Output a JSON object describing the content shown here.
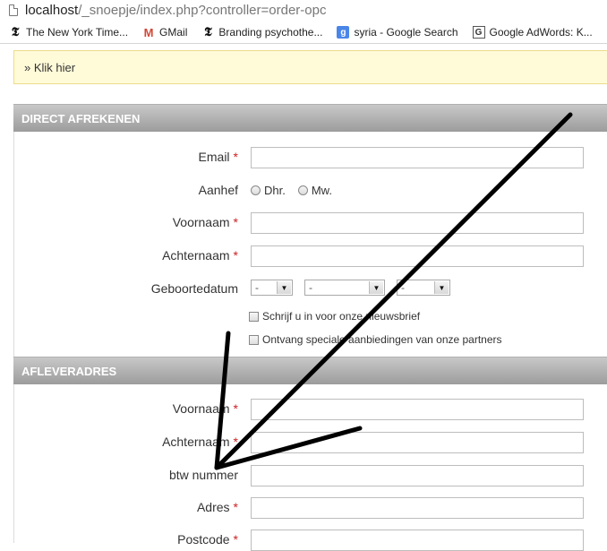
{
  "browser": {
    "url_host": "localhost",
    "url_path": "/_snoepje/index.php?controller=order-opc",
    "bookmarks": [
      {
        "label": "The New York Time...",
        "icon": "nyt-icon"
      },
      {
        "label": "GMail",
        "icon": "gmail-icon"
      },
      {
        "label": "Branding psychothe...",
        "icon": "nyt-icon"
      },
      {
        "label": "syria - Google Search",
        "icon": "google-search-icon"
      },
      {
        "label": "Google AdWords: K...",
        "icon": "adwords-icon"
      }
    ]
  },
  "notice": {
    "text": "» Klik hier"
  },
  "section_direct": {
    "title": "DIRECT AFREKENEN",
    "email_label": "Email",
    "aanhef_label": "Aanhef",
    "aanhef_options": [
      "Dhr.",
      "Mw."
    ],
    "voornaam_label": "Voornaam",
    "achternaam_label": "Achternaam",
    "geboortedatum_label": "Geboortedatum",
    "day_value": "-",
    "month_value": "-",
    "year_value": "-",
    "newsletter_label": "Schrijf u in voor onze nieuwsbrief",
    "partners_label": "Ontvang speciale aanbiedingen van onze partners"
  },
  "section_afleveradres": {
    "title": "AFLEVERADRES",
    "voornaam_label": "Voornaam",
    "achternaam_label": "Achternaam",
    "btw_label": "btw nummer",
    "adres_label": "Adres",
    "postcode_label": "Postcode"
  },
  "required_marker": "*",
  "colors": {
    "notice_bg": "#fffbd9",
    "header_gradient_top": "#c8c8c8",
    "header_gradient_bottom": "#9c9c9c",
    "required": "#cc2222",
    "arrow": "#000000"
  }
}
